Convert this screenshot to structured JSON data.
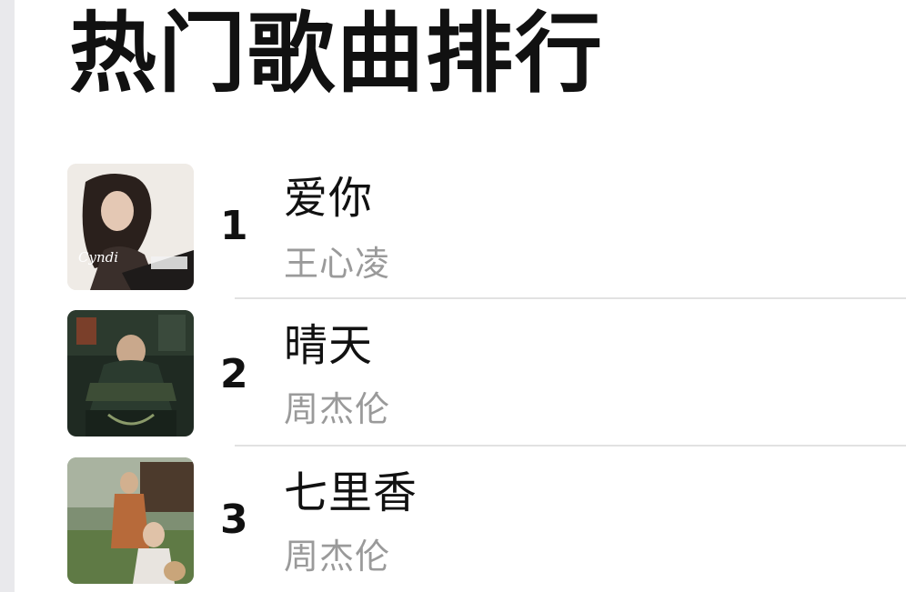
{
  "page": {
    "title": "热门歌曲排行"
  },
  "songs": [
    {
      "rank": "1",
      "title": "爱你",
      "artist": "王心凌",
      "cover_icon": "album-cover-ai-ni"
    },
    {
      "rank": "2",
      "title": "晴天",
      "artist": "周杰伦",
      "cover_icon": "album-cover-qing-tian"
    },
    {
      "rank": "3",
      "title": "七里香",
      "artist": "周杰伦",
      "cover_icon": "album-cover-qi-li-xiang"
    }
  ],
  "colors": {
    "background": "#ffffff",
    "title_text": "#111111",
    "artist_text": "#9a9a9a",
    "divider": "#e2e2e2"
  }
}
